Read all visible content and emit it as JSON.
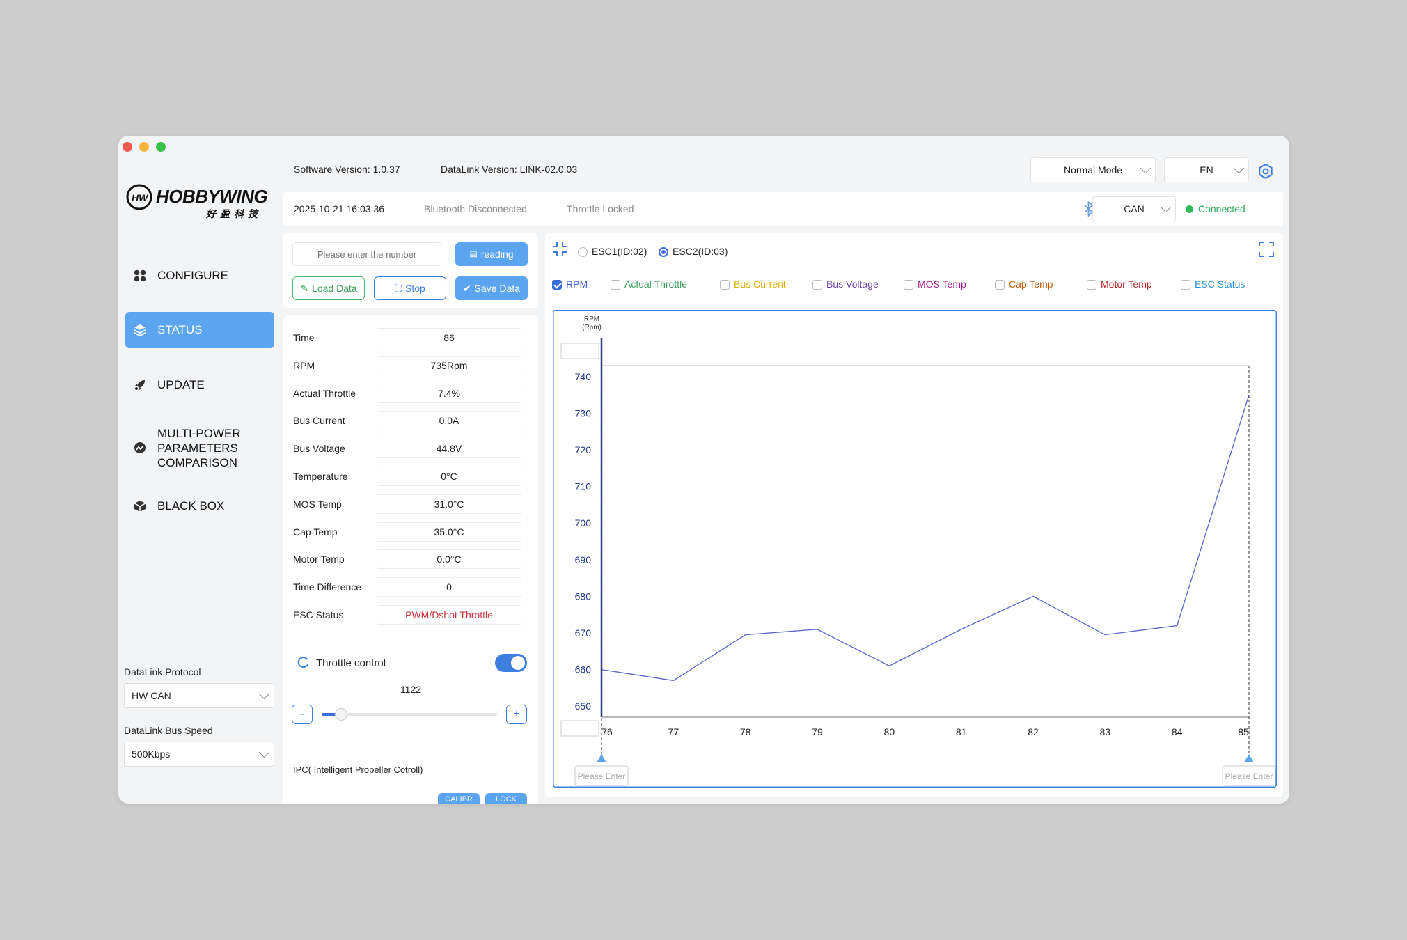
{
  "header": {
    "software_version": "Software Version: 1.0.37",
    "datalink_version": "DataLink Version: LINK-02.0.03",
    "mode": "Normal Mode",
    "language": "EN"
  },
  "logo": {
    "text": "HOBBYWING",
    "sub": "好盈科技"
  },
  "statusbar": {
    "datetime": "2025-10-21 16:03:36",
    "bluetooth": "Bluetooth Disconnected",
    "throttle": "Throttle Locked",
    "protocol": "CAN",
    "connection": "Connected"
  },
  "sidebar": {
    "items": [
      {
        "label": "CONFIGURE"
      },
      {
        "label": "STATUS"
      },
      {
        "label": "UPDATE"
      },
      {
        "label": "MULTI-POWER PARAMETERS COMPARISON"
      },
      {
        "label": "BLACK BOX"
      }
    ],
    "protocol_label": "DataLink Protocol",
    "protocol_value": "HW CAN",
    "speed_label": "DataLink Bus Speed",
    "speed_value": "500Kbps"
  },
  "controls": {
    "number_placeholder": "Please enter the number",
    "reading": "reading",
    "load": "Load Data",
    "stop": "Stop",
    "save": "Save Data"
  },
  "status_rows": [
    {
      "label": "Time",
      "value": "86"
    },
    {
      "label": "RPM",
      "value": "735Rpm"
    },
    {
      "label": "Actual Throttle",
      "value": "7.4%"
    },
    {
      "label": "Bus Current",
      "value": "0.0A"
    },
    {
      "label": "Bus Voltage",
      "value": "44.8V"
    },
    {
      "label": "Temperature",
      "value": "0°C"
    },
    {
      "label": "MOS Temp",
      "value": "31.0°C"
    },
    {
      "label": "Cap Temp",
      "value": "35.0°C"
    },
    {
      "label": "Motor Temp",
      "value": "0.0°C"
    },
    {
      "label": "Time Difference",
      "value": "0"
    },
    {
      "label": "ESC Status",
      "value": "PWM/Dshot Throttle"
    }
  ],
  "throttle": {
    "label": "Throttle control",
    "value": "1122",
    "fraction": 0.11,
    "minus": "-",
    "plus": "+"
  },
  "ipc": {
    "label": "IPC( Intelligent Propeller Cotroll)",
    "calib": "CALIBR",
    "lock": "LOCK"
  },
  "esc_select": {
    "esc1": "ESC1(ID:02)",
    "esc2": "ESC2(ID:03)",
    "selected": "esc2"
  },
  "legend": [
    {
      "label": "RPM",
      "color": "#3d5fd6",
      "checked": true
    },
    {
      "label": "Actual Throttle",
      "color": "#3aa15b",
      "checked": false
    },
    {
      "label": "Bus Current",
      "color": "#e0b000",
      "checked": false
    },
    {
      "label": "Bus Voltage",
      "color": "#6a3fa8",
      "checked": false
    },
    {
      "label": "MOS Temp",
      "color": "#a8208f",
      "checked": false
    },
    {
      "label": "Cap Temp",
      "color": "#c45a00",
      "checked": false
    },
    {
      "label": "Motor Temp",
      "color": "#b8282c",
      "checked": false
    },
    {
      "label": "ESC Status",
      "color": "#2a8fd6",
      "checked": false
    }
  ],
  "range_placeholders": {
    "left": "Please Enter",
    "right": "Please Enter"
  },
  "chart_data": {
    "type": "line",
    "ylabel": "RPM\n(Rpm)",
    "x": [
      76,
      77,
      78,
      79,
      80,
      81,
      82,
      83,
      84,
      85
    ],
    "series": [
      {
        "name": "RPM",
        "color": "#5a64c8",
        "values": [
          660,
          657,
          669.5,
          671,
          661,
          671,
          680,
          669.5,
          672,
          735
        ]
      }
    ],
    "xlim": [
      76,
      85
    ],
    "ylim": [
      647,
      743
    ],
    "yticks": [
      650,
      660,
      670,
      680,
      690,
      700,
      710,
      720,
      730,
      740
    ],
    "xticks": [
      76,
      77,
      78,
      79,
      80,
      81,
      82,
      83,
      84,
      85
    ]
  }
}
